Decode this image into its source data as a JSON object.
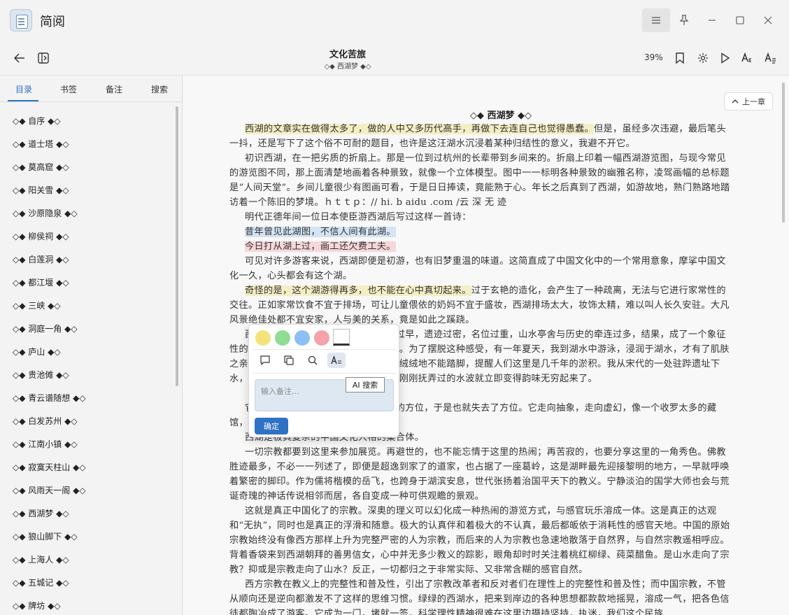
{
  "app": {
    "title": "简阅"
  },
  "toolbar": {
    "book_title": "文化苦旅",
    "chapter_subtitle": "◇◆ 西湖梦 ◆◇",
    "progress": "39%"
  },
  "sidebar": {
    "tabs": [
      "目录",
      "书签",
      "备注",
      "搜索"
    ],
    "active_tab": "目录",
    "toc": [
      "◇◆ 自序 ◆◇",
      "◇◆ 道士塔 ◆◇",
      "◇◆ 莫高窟 ◆◇",
      "◇◆ 阳关雪 ◆◇",
      "◇◆ 沙原隐泉 ◆◇",
      "◇◆ 柳侯祠 ◆◇",
      "◇◆ 白莲洞 ◆◇",
      "◇◆ 都江堰 ◆◇",
      "◇◆ 三峡 ◆◇",
      "◇◆ 洞庭一角 ◆◇",
      "◇◆ 庐山 ◆◇",
      "◇◆ 贵池傩 ◆◇",
      "◇◆ 青云谱随想 ◆◇",
      "◇◆ 白发苏州 ◆◇",
      "◇◆ 江南小镇 ◆◇",
      "◇◆ 寂寞天柱山 ◆◇",
      "◇◆ 风雨天一阁 ◆◇",
      "◇◆ 西湖梦 ◆◇",
      "◇◆ 狼山脚下 ◆◇",
      "◇◆ 上海人 ◆◇",
      "◇◆ 五城记 ◆◇",
      "◇◆ 牌坊 ◆◇"
    ]
  },
  "content": {
    "prev_chapter": "上一章",
    "heading": "◇◆ 西湖梦 ◆◇",
    "p1_hl": "西湖的文章实在做得太多了，做的人中又多历代高手，再做下去连自己也觉得愚蠢。",
    "p1_rest": "但是，虽经多次违避，最后笔头一抖，还是写下了这个俗不可耐的题目，也许是这汪湖水沉浸着某种归结性的意义，我避不开它。",
    "p2": "初识西湖，在一把劣质的折扇上。那是一位到过杭州的长辈带到乡间来的。折扇上印着一幅西湖游览图，与现今常见的游览图不同，那上面清楚地画着各种景致，就像一个立体模型。图中一一标明各种景致的幽雅名称，凌驾画幅的总标题是“人间天堂”。乡间儿童很少有图画可看，于是日日捧读，竟能熟于心。年长之后真到了西湖，如游故地，熟门熟路地踏访着一个陈旧的梦境。ｈｔｔｐ：// hi. b aidu .com /云 深 无 迹",
    "p3": "明代正德年间一位日本使臣游西湖后写过这样一首诗：",
    "poem1": "昔年曾见此湖图，不信人间有此湖。",
    "poem2": "今日打从湖上过，画工还欠费工夫。",
    "p4": "可见对许多游客来说，西湖即便是初游，也有旧梦重温的味道。这简直成了中国文化中的一个常用意象，摩挲中国文化一久，心头都会有这个湖。",
    "p5_hl": "奇怪的是，这个湖游得再多，也不能在心中真切起来。",
    "p5_rest": "过于玄艳的造化，会产生了一种疏离，无法与它进行家常性的交往。正如家常饮食不宜于排场，可让儿童偎依的奶妈不宜于盛妆，西湖排场太大，妆饰太精，难以叫人长久安驻。大凡风景绝佳处都不宜安家，人与美的关系，竟是如此之蹊跷。",
    "p6": "西湖的盛大，归拢来说，在于它成名过早，遗迹过密，名位过重，山水亭舍与历史的牵连过多，结果，成了一个象征性的存在。游览可以，贴近去却未免吃力。为了摆脱这种感受，有一年夏天，我到湖水中游泳，浸润于湖水，才有了肌肤之亲。湖水并不凉快，湖底也不深，却软绒绒地不能踏脚，提醒人们这里是几千年的淤积。我从宋代的一处驻跸遗址下水，游到一位清人的遗宅终止的，于是，刚刚抚弄过的水波就立即变得韵味无穷起来了。",
    "p7": "它贮存了太多的朝代，它汇聚了太多的方位，于是也就失去了方位。它走向抽象，走向虚幻，像一个收罗太多的藏馆，成了缥缈。",
    "p8": "西湖是极其复杂的中国文化人格的集合体。",
    "p9": "一切宗教都要到这里来参加展览。再避世的，也不能忘情于这里的热闹；再苦寂的，也要分享这里的一角秀色。佛教胜迹最多，不必一一列述了，即便是超逸到家了的道家，也占据了一座葛岭，这是湖畔最先迎接黎明的地方，一早就呼唤着繁密的脚印。作为儒将楷模的岳飞，也跨身于湖滨安息，世代张扬着治国平天下的教义。宁静淡泊的国学大师也会与荒诞奇瑰的神话传说相邻而居，各自变成一种可供观瞻的景观。",
    "p10": "这就是真正中国化了的宗教。深奥的理义可以幻化成一种热闹的游览方式，与感官玩乐溶成一体。这是真正的达观和“无执”，同时也是真正的浮滑和随意。极大的认真伴和着极大的不认真，最后都皈依于消耗性的感官天地。中国的原始宗教始终没有像西方那样上升为完整严密的人为宗教，而后来的人为宗教也急速地散落于自然界，与自然宗教遥相呼应。背着香袋来到西湖朝拜的善男信女，心中并无多少教义的踪影，眼角却时时关注着桃红柳绿、莼菜醋鱼。是山水走向了宗教？抑或是宗教走向了山水？反正，一切都归之于非常实际、又非常含糊的感官自然。",
    "p11": "西方宗教在教义上的完整性和普及性，引出了宗教改革者和反对者们在理性上的完整性和普及性；而中国宗教，不管从顺向还是逆向都激发不了这样的思维习惯。绿绿的西湖水，把来到岸边的各种思想都款款地摇晃，溶成一气，把各色信徒都陶冶成了游客。它成为一门，堵就一签，科学理性精神很难在这里边摄持坚持，执迷，我们这个民族"
  },
  "popup": {
    "colors": [
      "#f3e37a",
      "#8fdc93",
      "#8cbff4",
      "#f4a3ab"
    ],
    "note_placeholder": "输入备注...",
    "confirm": "确定",
    "tooltip": "AI 搜索"
  }
}
